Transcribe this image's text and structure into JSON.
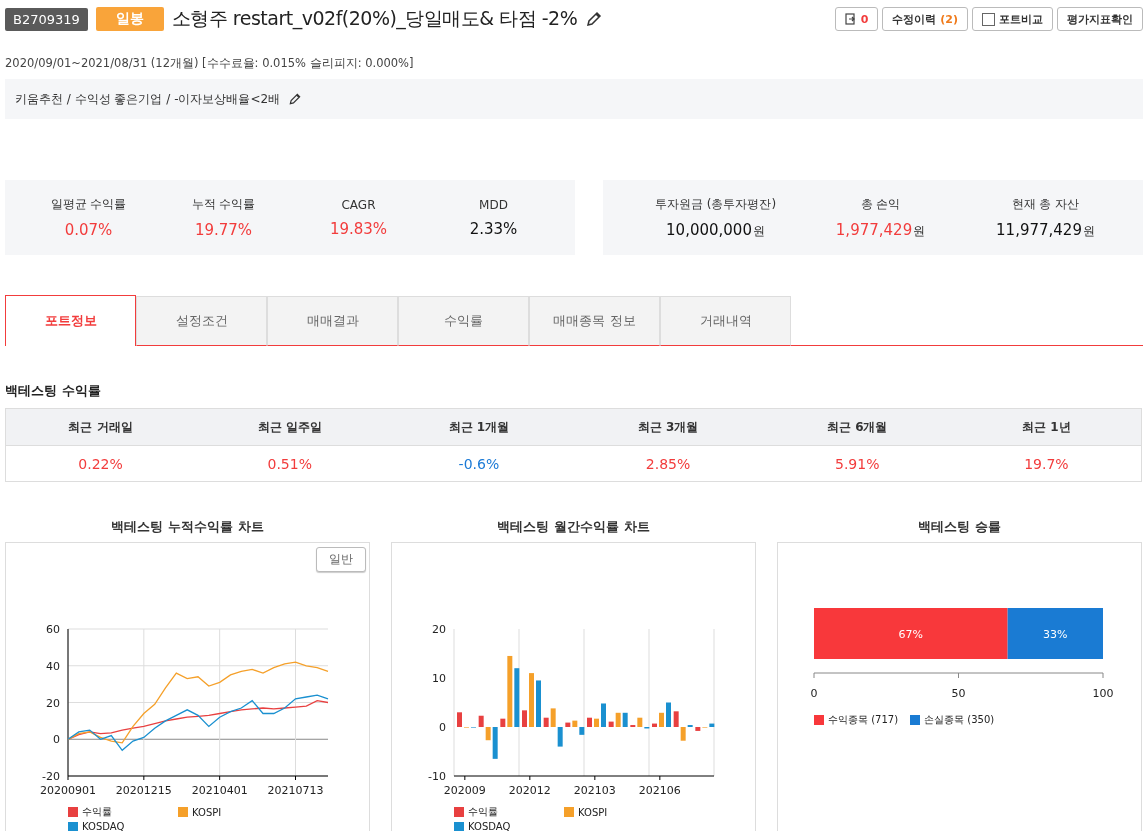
{
  "header": {
    "code": "B2709319",
    "period_badge": "일봉",
    "title": "소형주 restart_v02f(20%)_당일매도& 타점 -2%",
    "buttons": [
      {
        "kind": "copy",
        "label": "0"
      },
      {
        "kind": "history",
        "label": "수정이력",
        "count": "(2)"
      },
      {
        "kind": "check",
        "label": "포트비교",
        "checked": false
      },
      {
        "kind": "plain",
        "label": "평가지표확인"
      }
    ]
  },
  "period_info": "2020/09/01~2021/08/31 (12개월) [수수료율: 0.015% 슬리피지: 0.000%]",
  "description": "키움추천 / 수익성 좋은기업 / -이자보상배율<2배",
  "summary_left": [
    {
      "label": "일평균 수익률",
      "value": "0.07%",
      "color": "#f23c3c"
    },
    {
      "label": "누적 수익률",
      "value": "19.77%",
      "color": "#f23c3c"
    },
    {
      "label": "CAGR",
      "value": "19.83%",
      "color": "#f23c3c"
    },
    {
      "label": "MDD",
      "value": "2.33%",
      "color": "#111111"
    }
  ],
  "summary_right": [
    {
      "label": "투자원금 (총투자평잔)",
      "value": "10,000,000",
      "unit": "원",
      "color": "#111111"
    },
    {
      "label": "총 손익",
      "value": "1,977,429",
      "unit": "원",
      "color": "#f23c3c"
    },
    {
      "label": "현재 총 자산",
      "value": "11,977,429",
      "unit": "원",
      "color": "#111111"
    }
  ],
  "tabs": [
    {
      "label": "포트정보",
      "selected": true
    },
    {
      "label": "설정조건",
      "selected": false
    },
    {
      "label": "매매결과",
      "selected": false
    },
    {
      "label": "수익률",
      "selected": false
    },
    {
      "label": "매매종목 정보",
      "selected": false
    },
    {
      "label": "거래내역",
      "selected": false
    }
  ],
  "returns": {
    "title": "백테스팅 수익률",
    "columns": [
      {
        "label": "최근 거래일",
        "value": "0.22%",
        "color": "#f23c3c"
      },
      {
        "label": "최근 일주일",
        "value": "0.51%",
        "color": "#f23c3c"
      },
      {
        "label": "최근 1개월",
        "value": "-0.6%",
        "color": "#1b7ad6"
      },
      {
        "label": "최근 3개월",
        "value": "2.85%",
        "color": "#f23c3c"
      },
      {
        "label": "최근 6개월",
        "value": "5.91%",
        "color": "#f23c3c"
      },
      {
        "label": "최근 1년",
        "value": "19.7%",
        "color": "#f23c3c"
      }
    ]
  },
  "charts": [
    {
      "title": "백테스팅 누적수익률 차트",
      "mode_button": "일반",
      "chart_data": {
        "type": "line",
        "categories": [
          "20200901",
          null,
          null,
          null,
          null,
          null,
          null,
          "20201215",
          null,
          null,
          null,
          null,
          null,
          null,
          "20210401",
          null,
          null,
          null,
          null,
          null,
          null,
          "20210713",
          null,
          null,
          null
        ],
        "ylim": [
          -20,
          60
        ],
        "yticks": [
          -20,
          0,
          20,
          40,
          60
        ],
        "grid": true,
        "series": [
          {
            "name": "수익률",
            "color": "#e84040",
            "values": [
              0,
              2.5,
              4,
              3,
              3.5,
              5,
              6,
              7,
              8.5,
              10,
              11,
              12,
              12.5,
              13,
              14,
              15,
              16,
              16.5,
              17,
              16.5,
              17,
              17.5,
              18,
              21,
              20
            ]
          },
          {
            "name": "KOSPI",
            "color": "#f5a02a",
            "values": [
              0,
              3,
              4,
              1,
              -1,
              -2,
              7,
              14,
              19,
              28,
              36,
              33,
              34,
              29,
              31,
              35,
              37,
              38,
              36,
              39,
              41,
              42,
              40,
              39,
              37
            ]
          },
          {
            "name": "KOSDAQ",
            "color": "#1a90d0",
            "values": [
              0,
              4,
              5,
              0,
              2,
              -6,
              -1,
              1,
              6,
              10,
              13,
              16,
              13,
              7,
              12,
              15,
              17,
              21,
              14,
              14,
              17,
              22,
              23,
              24,
              22
            ]
          }
        ]
      }
    },
    {
      "title": "백테스팅 월간수익률 차트",
      "chart_data": {
        "type": "bar",
        "categories": [
          "202009",
          null,
          null,
          "202012",
          null,
          null,
          "202103",
          null,
          null,
          "202106",
          null,
          null
        ],
        "ylim": [
          -10,
          20
        ],
        "yticks": [
          -10,
          0,
          10,
          20
        ],
        "grid": true,
        "series": [
          {
            "name": "수익률",
            "color": "#e84040",
            "values": [
              3.0,
              2.3,
              1.7,
              3.4,
              1.9,
              0.9,
              1.9,
              1.1,
              0.4,
              0.7,
              3.2,
              -0.8
            ]
          },
          {
            "name": "KOSPI",
            "color": "#f5a02a",
            "values": [
              0,
              -2.7,
              14.5,
              11,
              3.8,
              1.3,
              1.7,
              2.9,
              1.9,
              2.9,
              -2.8,
              0
            ]
          },
          {
            "name": "KOSDAQ",
            "color": "#1a90d0",
            "values": [
              0,
              -6.5,
              12,
              9.5,
              -4,
              -1.6,
              4.8,
              2.9,
              -0.3,
              5,
              0.4,
              0.7
            ]
          }
        ]
      }
    },
    {
      "title": "백테스팅 승률",
      "chart_data": {
        "type": "bar",
        "orientation": "horizontal",
        "stacked": true,
        "xlim": [
          0,
          100
        ],
        "xticks": [
          0,
          50,
          100
        ],
        "series": [
          {
            "name": "수익종목 (717)",
            "color": "#f8383b",
            "values": [
              67
            ],
            "value_labels": [
              "67%"
            ]
          },
          {
            "name": "손실종목 (350)",
            "color": "#1a7bd3",
            "values": [
              33
            ],
            "value_labels": [
              "33%"
            ]
          }
        ]
      }
    }
  ]
}
